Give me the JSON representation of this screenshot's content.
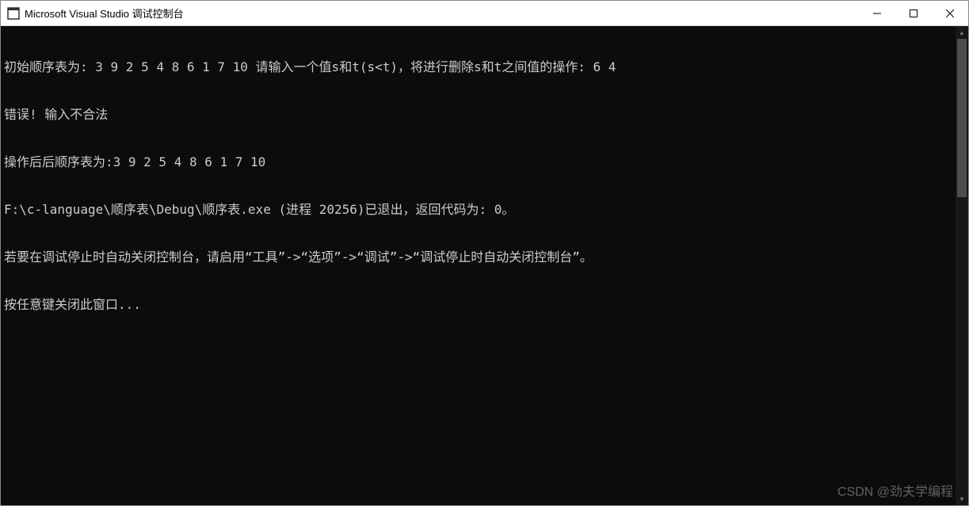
{
  "window": {
    "title": "Microsoft Visual Studio 调试控制台"
  },
  "console": {
    "lines": [
      "初始顺序表为: 3 9 2 5 4 8 6 1 7 10 请输入一个值s和t(s<t)，将进行删除s和t之间值的操作: 6 4",
      "错误! 输入不合法",
      "操作后后顺序表为:3 9 2 5 4 8 6 1 7 10",
      "F:\\c-language\\顺序表\\Debug\\顺序表.exe (进程 20256)已退出，返回代码为: 0。",
      "若要在调试停止时自动关闭控制台，请启用“工具”->“选项”->“调试”->“调试停止时自动关闭控制台”。",
      "按任意键关闭此窗口..."
    ]
  },
  "watermark": "CSDN @劲夫学编程"
}
